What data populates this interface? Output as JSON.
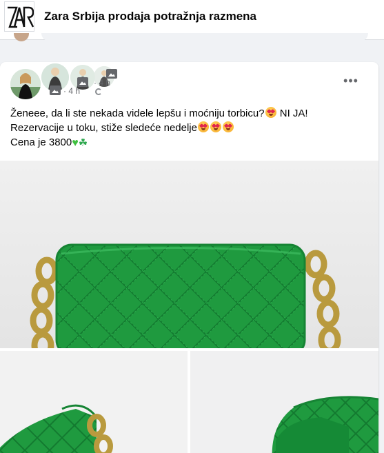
{
  "group": {
    "name": "Zara Srbija prodaja potražnja razmena",
    "logo_text": "ZAR"
  },
  "post": {
    "author_avatar_icon": "author-avatar",
    "time_1": "· 4 h",
    "time_2": "· 4 h",
    "more_icon": "•••",
    "text_line1": "Ženeee, da li ste nekada videle lepšu i moćniju torbicu?",
    "text_line1_tail": " NI JA!",
    "text_line2": "Rezervacije u toku, stiže sledeće nedelje",
    "text_line3": "Cena je 3800",
    "media": [
      {
        "name": "green-quilted-bag-front",
        "description_icon": "photo"
      },
      {
        "name": "green-quilted-bag-chain-detail",
        "description_icon": "photo"
      },
      {
        "name": "green-quilted-bag-open",
        "description_icon": "photo"
      }
    ]
  },
  "colors": {
    "bag_green": "#1f9a3f",
    "chain_gold": "#b99a3e",
    "text_primary": "#050505",
    "text_secondary": "#65676b"
  }
}
